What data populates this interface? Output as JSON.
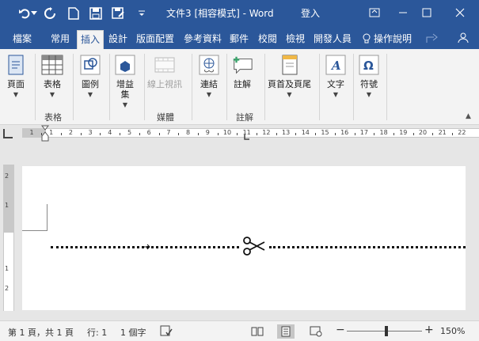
{
  "titlebar": {
    "title": "文件3 [相容模式] - Word",
    "login": "登入",
    "qa_icons": [
      "undo-icon",
      "redo-icon",
      "new-document-icon",
      "save-icon",
      "save-as-icon",
      "customize-icon"
    ],
    "window_icons": [
      "ribbon-display-icon",
      "minimize-icon",
      "maximize-icon",
      "close-icon"
    ]
  },
  "tabs": [
    "檔案",
    "常用",
    "插入",
    "設計",
    "版面配置",
    "參考資料",
    "郵件",
    "校閱",
    "檢視",
    "開發人員"
  ],
  "active_tab": "插入",
  "tellme": "操作說明",
  "ribbon": {
    "buttons": {
      "page": "頁面",
      "table": "表格",
      "illustrations": "圖例",
      "addins_1": "增益",
      "addins_2": "集",
      "online_video": "線上視訊",
      "links": "連結",
      "comment": "註解",
      "header_footer": "頁首及頁尾",
      "text": "文字",
      "symbols": "符號"
    },
    "groups": {
      "tables": "表格",
      "media": "媒體",
      "comments": "註解"
    }
  },
  "ruler": {
    "numbers": [
      "1",
      "1",
      "2",
      "3",
      "4",
      "5",
      "6",
      "7",
      "8",
      "9",
      "10",
      "11",
      "12",
      "13",
      "14",
      "15",
      "16",
      "17",
      "18",
      "19",
      "20",
      "21",
      "22"
    ],
    "vertical_numbers": [
      "2",
      "1",
      "1",
      "2"
    ]
  },
  "status": {
    "page": "第 1 頁，共 1 頁",
    "line": "行: 1",
    "words": "1 個字",
    "zoom": "150%",
    "minus": "−",
    "plus": "+"
  },
  "colors": {
    "accent": "#2b579a",
    "ribbon_bg": "#f3f3f3",
    "workspace": "#e6e6e6"
  }
}
